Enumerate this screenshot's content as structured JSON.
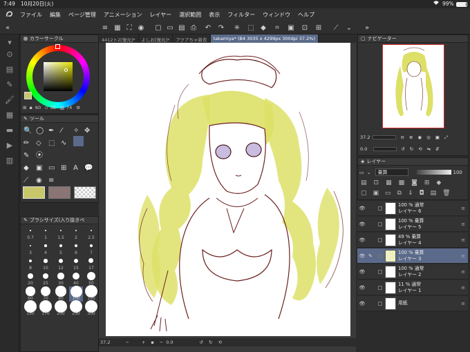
{
  "status": {
    "time": "7:49",
    "date": "10月20日(火)",
    "battery": "99%"
  },
  "menu": {
    "items": [
      "ファイル",
      "編集",
      "ページ管理",
      "アニメーション",
      "レイヤー",
      "選択範囲",
      "表示",
      "フィルター",
      "ウィンドウ",
      "ヘルプ"
    ]
  },
  "color_panel": {
    "title": "カラーサークル",
    "h": "60",
    "s": "38",
    "v": "74",
    "main_color": "#c8c66a"
  },
  "tool_panel": {
    "title": "ツール"
  },
  "brush_panel": {
    "title": "ブラシサイズ(入り抜きペ",
    "sizes": [
      "0.7",
      "1",
      "1.5",
      "2",
      "2.5",
      "3",
      "4",
      "5",
      "6",
      "7",
      "8",
      "10",
      "12",
      "15",
      "17",
      "20",
      "25",
      "30",
      "40",
      "50",
      "60",
      "70",
      "80",
      "100",
      "120",
      "150",
      "170",
      "200",
      "250",
      "300"
    ],
    "selected": "100"
  },
  "doc_tabs": [
    "4412ト2[復元]*",
    "よしお[復元]*",
    "アクアちゃ新衣",
    "takamiya* (B4 3035 x 4299px 300dpi 37.2%)"
  ],
  "canvas_bottom": {
    "zoom": "37.2",
    "rotate": "0.0"
  },
  "navigator": {
    "title": "ナビゲーター",
    "zoom": "37.2",
    "angle": "0.0"
  },
  "layer_panel": {
    "title": "レイヤー",
    "blend": "乗算",
    "opacity": "100",
    "layers": [
      {
        "opacity_mode": "100 % 通常",
        "name": "レイヤー 6",
        "selected": false
      },
      {
        "opacity_mode": "100 % 乗算",
        "name": "レイヤー 5",
        "selected": false
      },
      {
        "opacity_mode": "49 % 乗算",
        "name": "レイヤー 4",
        "selected": false
      },
      {
        "opacity_mode": "100 % 乗算",
        "name": "レイヤー 3",
        "selected": true
      },
      {
        "opacity_mode": "100 % 通常",
        "name": "レイヤー 2",
        "selected": false
      },
      {
        "opacity_mode": "11 % 通常",
        "name": "レイヤー 1",
        "selected": false
      },
      {
        "opacity_mode": "",
        "name": "用紙",
        "selected": false
      }
    ]
  },
  "colors": {
    "accent": "#5b6a8a",
    "hair": "#dde066",
    "line": "#6b1f1f"
  }
}
